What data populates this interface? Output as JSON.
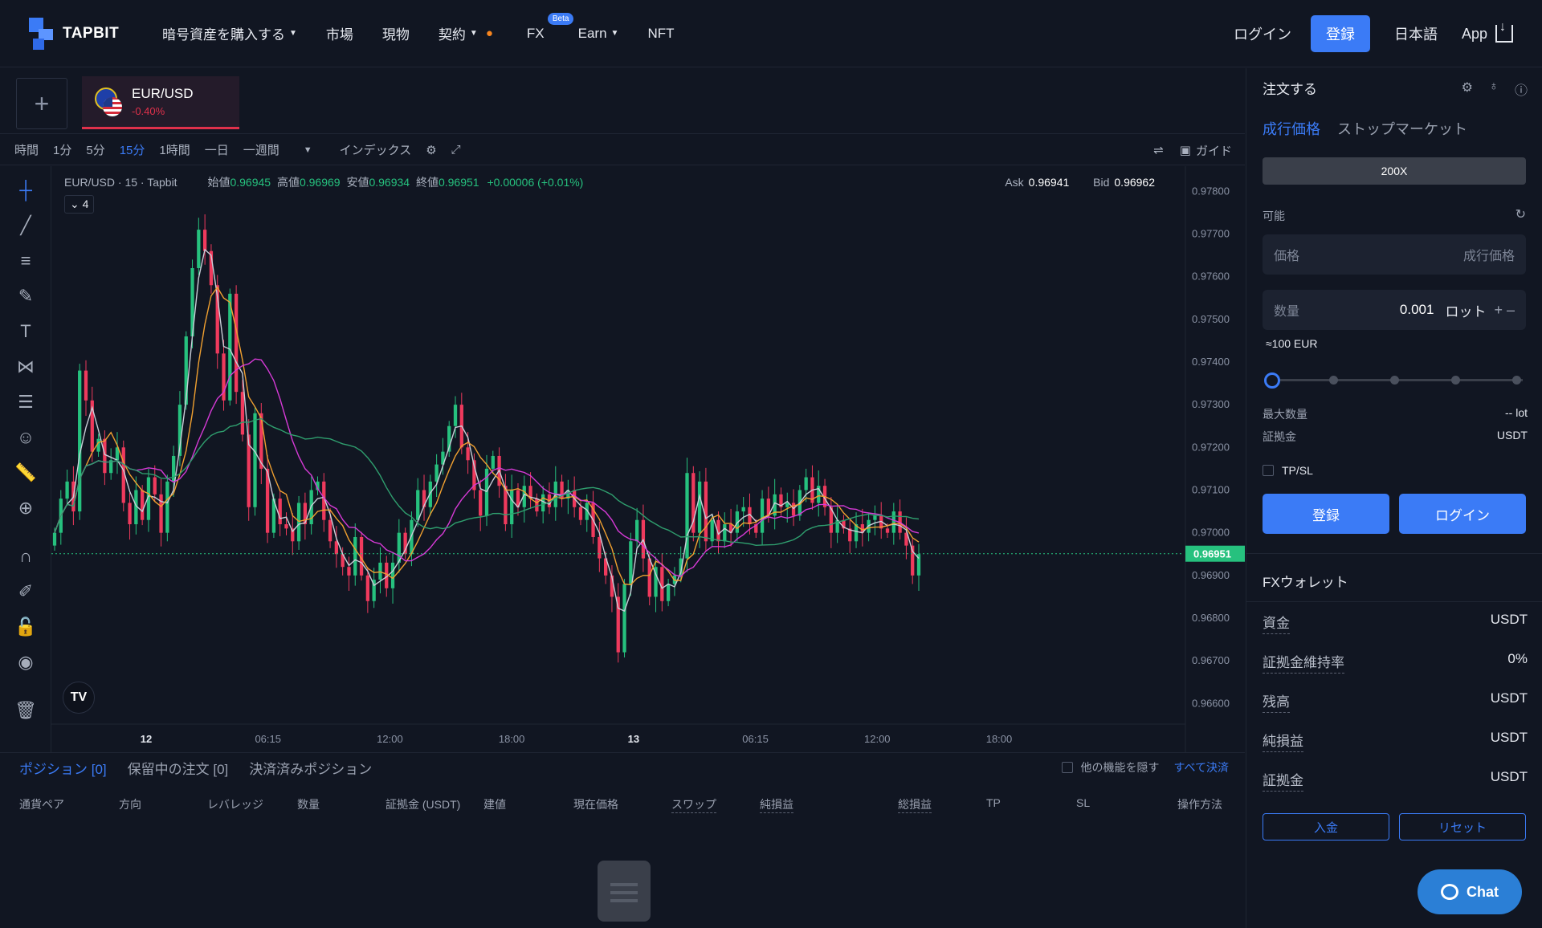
{
  "nav": {
    "logo": "TAPBIT",
    "items": [
      {
        "label": "暗号資産を購入する",
        "caret": true
      },
      {
        "label": "市場"
      },
      {
        "label": "現物"
      },
      {
        "label": "契約",
        "caret": true,
        "fire": true
      },
      {
        "label": "FX",
        "badge": "Beta"
      },
      {
        "label": "Earn",
        "caret": true
      },
      {
        "label": "NFT"
      }
    ],
    "login": "ログイン",
    "register": "登録",
    "language": "日本語",
    "app": "App"
  },
  "tab": {
    "pair": "EUR/USD",
    "change": "-0.40%"
  },
  "toolbar": {
    "intervals": [
      "時間",
      "1分",
      "5分",
      "15分",
      "1時間",
      "一日",
      "一週間"
    ],
    "active": "15分",
    "index": "インデックス",
    "guide": "ガイド"
  },
  "chart_info": {
    "symbol": "EUR/USD · 15 · Tapbit",
    "open_label": "始値",
    "open": "0.96945",
    "high_label": "高値",
    "high": "0.96969",
    "low_label": "安値",
    "low": "0.96934",
    "close_label": "終値",
    "close": "0.96951",
    "change": "+0.00006 (+0.01%)",
    "indicators": "4",
    "ask_label": "Ask",
    "ask": "0.96941",
    "bid_label": "Bid",
    "bid": "0.96962",
    "tv": "TV"
  },
  "chart_data": {
    "type": "candlestick",
    "y_ticks": [
      "0.97800",
      "0.97700",
      "0.97600",
      "0.97500",
      "0.97400",
      "0.97300",
      "0.97200",
      "0.97100",
      "0.97000",
      "0.96900",
      "0.96800",
      "0.96700",
      "0.96600"
    ],
    "x_ticks": [
      "12",
      "06:15",
      "12:00",
      "18:00",
      "13",
      "06:15",
      "12:00",
      "18:00"
    ],
    "last_price": "0.96951",
    "ylim": [
      0.9658,
      0.9784
    ],
    "close_series": [
      0.97,
      0.9708,
      0.9712,
      0.9705,
      0.9738,
      0.9731,
      0.9719,
      0.9722,
      0.9714,
      0.9717,
      0.972,
      0.9707,
      0.9702,
      0.971,
      0.9703,
      0.9713,
      0.9709,
      0.97,
      0.9712,
      0.9718,
      0.973,
      0.9746,
      0.9762,
      0.9771,
      0.9766,
      0.9758,
      0.9742,
      0.9731,
      0.9756,
      0.9733,
      0.9723,
      0.9706,
      0.9728,
      0.9715,
      0.97,
      0.9708,
      0.9702,
      0.9701,
      0.9698,
      0.9707,
      0.9702,
      0.971,
      0.9712,
      0.9703,
      0.9698,
      0.9695,
      0.9692,
      0.969,
      0.9699,
      0.969,
      0.9684,
      0.9689,
      0.9693,
      0.9687,
      0.9693,
      0.97,
      0.9695,
      0.9703,
      0.971,
      0.9706,
      0.9712,
      0.9716,
      0.9719,
      0.9725,
      0.973,
      0.972,
      0.9717,
      0.971,
      0.9704,
      0.9715,
      0.9718,
      0.9711,
      0.9702,
      0.971,
      0.9706,
      0.9711,
      0.9708,
      0.9705,
      0.9709,
      0.9706,
      0.9712,
      0.9708,
      0.971,
      0.9706,
      0.9703,
      0.9707,
      0.9699,
      0.9694,
      0.969,
      0.9685,
      0.9672,
      0.9688,
      0.9698,
      0.9703,
      0.9694,
      0.9685,
      0.9692,
      0.9684,
      0.9688,
      0.969,
      0.9694,
      0.9714,
      0.97,
      0.9712,
      0.9698,
      0.9703,
      0.9698,
      0.9702,
      0.97,
      0.9705,
      0.9706,
      0.9702,
      0.97,
      0.9708,
      0.9704,
      0.9709,
      0.9706,
      0.9707,
      0.9704,
      0.971,
      0.9713,
      0.9707,
      0.9711,
      0.9706,
      0.97,
      0.9703,
      0.9701,
      0.9698,
      0.9702,
      0.97,
      0.9703,
      0.9704,
      0.9701,
      0.97,
      0.9705,
      0.97,
      0.9697,
      0.969,
      0.9695
    ]
  },
  "bottom": {
    "tabs": [
      "ポジション [0]",
      "保留中の注文 [0]",
      "決済済みポジション"
    ],
    "hide_other": "他の機能を隠す",
    "close_all": "すべて決済",
    "columns": [
      "通貨ペア",
      "方向",
      "レバレッジ",
      "数量",
      "証拠金 (USDT)",
      "建値",
      "現在価格",
      "スワップ",
      "純損益",
      "総損益",
      "TP",
      "SL",
      "操作方法"
    ]
  },
  "order": {
    "title": "注文する",
    "tabs": [
      "成行価格",
      "ストップマーケット"
    ],
    "leverage": "200X",
    "available": "可能",
    "price_label": "価格",
    "price_value": "成行価格",
    "qty_label": "数量",
    "qty_value": "0.001",
    "qty_unit": "ロット",
    "approx": "≈100 EUR",
    "slider_level": 0,
    "max_qty_label": "最大数量",
    "max_qty": "-- lot",
    "margin_label": "証拠金",
    "margin": "USDT",
    "tpsl": "TP/SL",
    "register_btn": "登録",
    "login_btn": "ログイン"
  },
  "wallet": {
    "title": "FXウォレット",
    "rows": [
      {
        "k": "資金",
        "v": "USDT"
      },
      {
        "k": "証拠金維持率",
        "v": "0%"
      },
      {
        "k": "残高",
        "v": "USDT"
      },
      {
        "k": "純損益",
        "v": "USDT"
      },
      {
        "k": "証拠金",
        "v": "USDT"
      }
    ],
    "deposit": "入金",
    "reset": "リセット"
  },
  "chat": "Chat"
}
